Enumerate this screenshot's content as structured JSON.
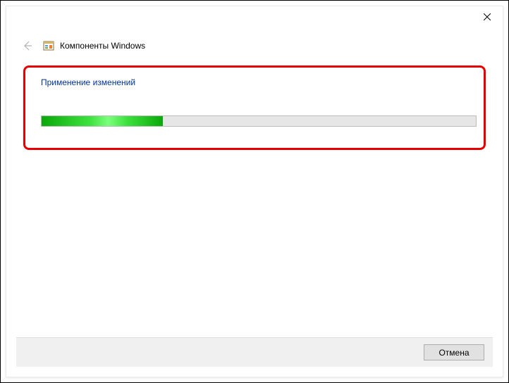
{
  "window": {
    "title": "Компоненты Windows"
  },
  "content": {
    "status_title": "Применение изменений",
    "progress_percent": 28
  },
  "footer": {
    "cancel_label": "Отмена"
  },
  "icons": {
    "close": "close-icon",
    "back": "back-arrow-icon",
    "app": "windows-features-icon"
  }
}
